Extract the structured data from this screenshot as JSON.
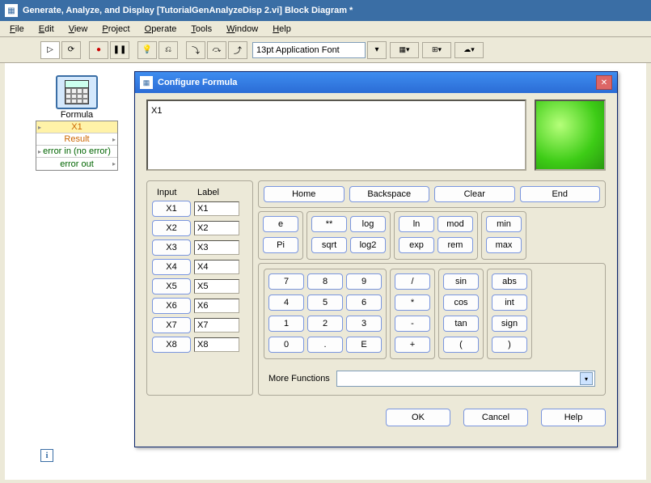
{
  "window": {
    "title": "Generate, Analyze, and Display [TutorialGenAnalyzeDisp 2.vi] Block Diagram *"
  },
  "menu": {
    "file": "File",
    "edit": "Edit",
    "view": "View",
    "project": "Project",
    "operate": "Operate",
    "tools": "Tools",
    "window": "Window",
    "help": "Help"
  },
  "toolbar": {
    "font": "13pt Application Font"
  },
  "node": {
    "label": "Formula",
    "rows": {
      "x1": "X1",
      "result": "Result",
      "errin": "error in (no error)",
      "errout": "error out"
    }
  },
  "dialog": {
    "title": "Configure Formula",
    "formula_value": "X1",
    "inputs": {
      "hdr_input": "Input",
      "hdr_label": "Label",
      "rows": [
        {
          "btn": "X1",
          "lbl": "X1"
        },
        {
          "btn": "X2",
          "lbl": "X2"
        },
        {
          "btn": "X3",
          "lbl": "X3"
        },
        {
          "btn": "X4",
          "lbl": "X4"
        },
        {
          "btn": "X5",
          "lbl": "X5"
        },
        {
          "btn": "X6",
          "lbl": "X6"
        },
        {
          "btn": "X7",
          "lbl": "X7"
        },
        {
          "btn": "X8",
          "lbl": "X8"
        }
      ]
    },
    "nav": {
      "home": "Home",
      "backspace": "Backspace",
      "clear": "Clear",
      "end": "End"
    },
    "const": {
      "e": "e",
      "pi": "Pi"
    },
    "pow": {
      "exp": "**",
      "sqrt": "sqrt"
    },
    "log": {
      "log": "log",
      "log2": "log2",
      "ln": "ln",
      "expn": "exp"
    },
    "mod": {
      "mod": "mod",
      "rem": "rem",
      "min": "min",
      "max": "max"
    },
    "num": {
      "n7": "7",
      "n8": "8",
      "n9": "9",
      "n4": "4",
      "n5": "5",
      "n6": "6",
      "n1": "1",
      "n2": "2",
      "n3": "3",
      "n0": "0",
      "dot": ".",
      "E": "E"
    },
    "ops": {
      "div": "/",
      "mul": "*",
      "sub": "-",
      "add": "+"
    },
    "trig": {
      "sin": "sin",
      "cos": "cos",
      "tan": "tan",
      "lpar": "("
    },
    "misc": {
      "abs": "abs",
      "int": "int",
      "sign": "sign",
      "rpar": ")"
    },
    "more_label": "More Functions",
    "ok": "OK",
    "cancel": "Cancel",
    "help": "Help"
  }
}
